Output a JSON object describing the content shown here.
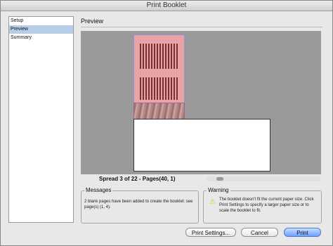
{
  "window": {
    "title": "Print Booklet"
  },
  "sidebar": {
    "items": [
      {
        "label": "Setup"
      },
      {
        "label": "Preview"
      },
      {
        "label": "Summary"
      }
    ]
  },
  "preview": {
    "heading": "Preview",
    "spread": "Spread 3 of 22 - Pages(40, 1)"
  },
  "messages": {
    "title": "Messages",
    "text": "2 blank pages have been added to create the booklet: see page(s) (1, 4)."
  },
  "warning": {
    "title": "Warning",
    "text": "The booklet doesn't fit the current paper size. Click Print Settings to specify a larger paper size or to scale the booklet to fit."
  },
  "buttons": {
    "print_settings": "Print Settings...",
    "cancel": "Cancel",
    "print": "Print"
  },
  "colors": {
    "accent": "#6aa2ff",
    "selection": "#b8cde8",
    "bleed": "#e8a3a7"
  }
}
